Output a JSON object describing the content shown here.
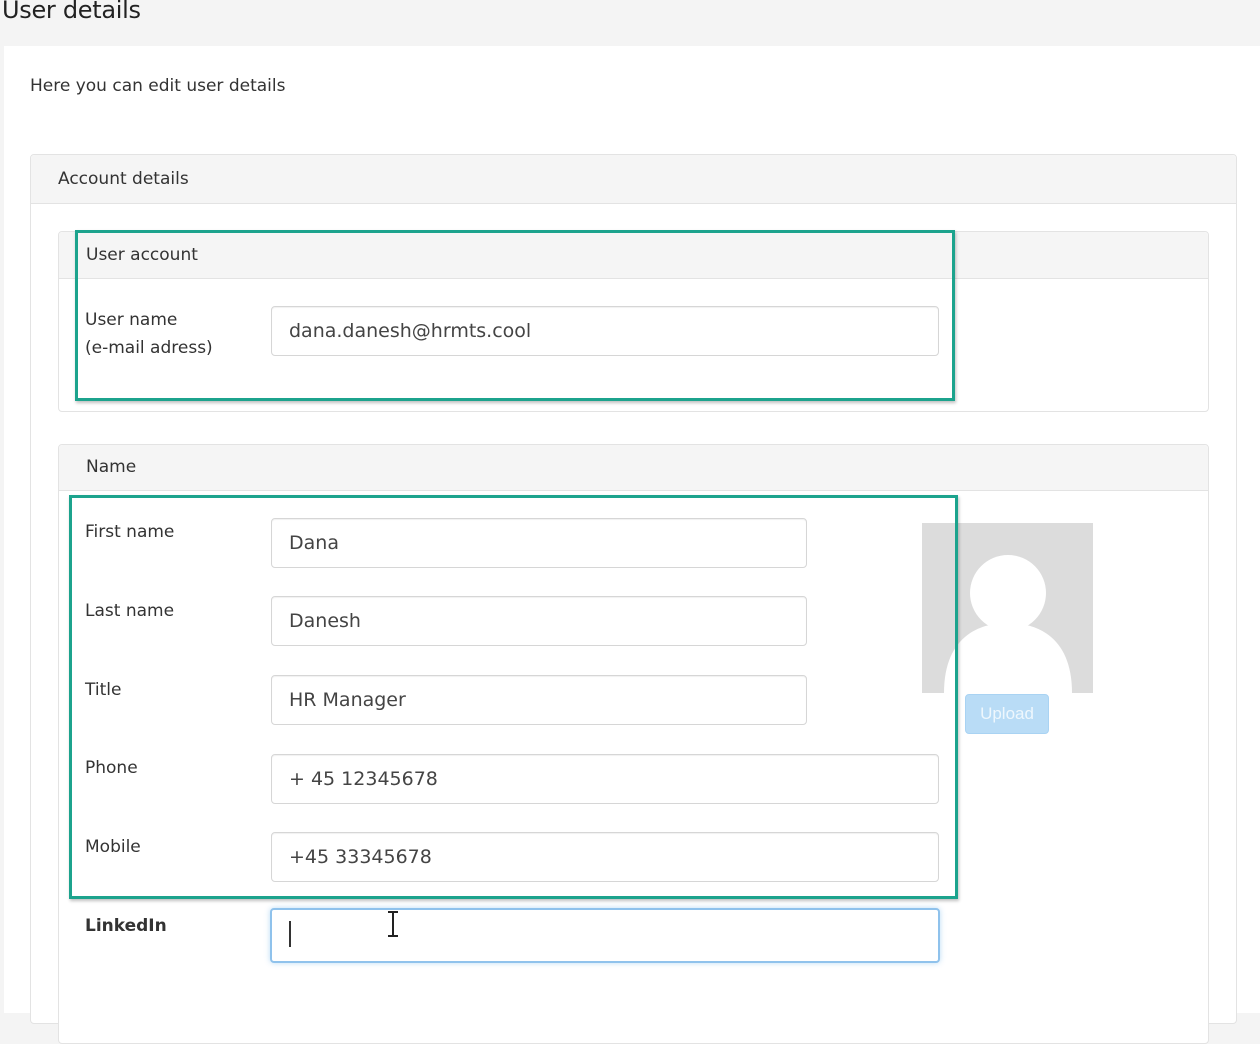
{
  "page": {
    "title": "User details",
    "intro": "Here you can edit user details"
  },
  "account_panel": {
    "heading": "Account details",
    "user_account": {
      "heading": "User account",
      "username_label_line1": "User name",
      "username_label_line2": "(e-mail adress)",
      "username_value": "dana.danesh@hrmts.cool"
    },
    "name_section": {
      "heading": "Name",
      "fields": {
        "first_name": {
          "label": "First name",
          "value": "Dana"
        },
        "last_name": {
          "label": "Last name",
          "value": "Danesh"
        },
        "title": {
          "label": "Title",
          "value": "HR Manager"
        },
        "phone": {
          "label": "Phone",
          "value": "+ 45 12345678"
        },
        "mobile": {
          "label": "Mobile",
          "value": "+45 33345678"
        },
        "linkedin": {
          "label": "LinkedIn",
          "value": ""
        }
      },
      "upload_label": "Upload"
    }
  },
  "colors": {
    "highlight_border": "#1ca38d",
    "focus_border": "#8fc2ec",
    "upload_button": "#b9dcf6"
  },
  "icons": {
    "avatar": "user-silhouette-icon",
    "cursor": "text-cursor-icon"
  }
}
